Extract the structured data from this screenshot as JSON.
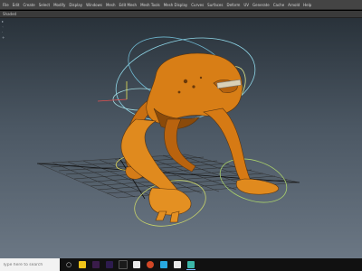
{
  "menubar": {
    "items": [
      "File",
      "Edit",
      "Create",
      "Select",
      "Modify",
      "Display",
      "Windows",
      "Mesh",
      "Edit Mesh",
      "Mesh Tools",
      "Mesh Display",
      "Curves",
      "Surfaces",
      "Deform",
      "UV",
      "Generate",
      "Cache",
      "Arnold",
      "Help"
    ]
  },
  "panel": {
    "label": "Shaded"
  },
  "taskbar": {
    "search_placeholder": "Type here to search",
    "app_colors": [
      "#f0c419",
      "#3a1c4a",
      "#2d1b4e",
      "#1a1a1a",
      "#e8e8e8",
      "#d24726",
      "#28a8e0",
      "#e8e8e8",
      "#3bb6a8"
    ]
  }
}
